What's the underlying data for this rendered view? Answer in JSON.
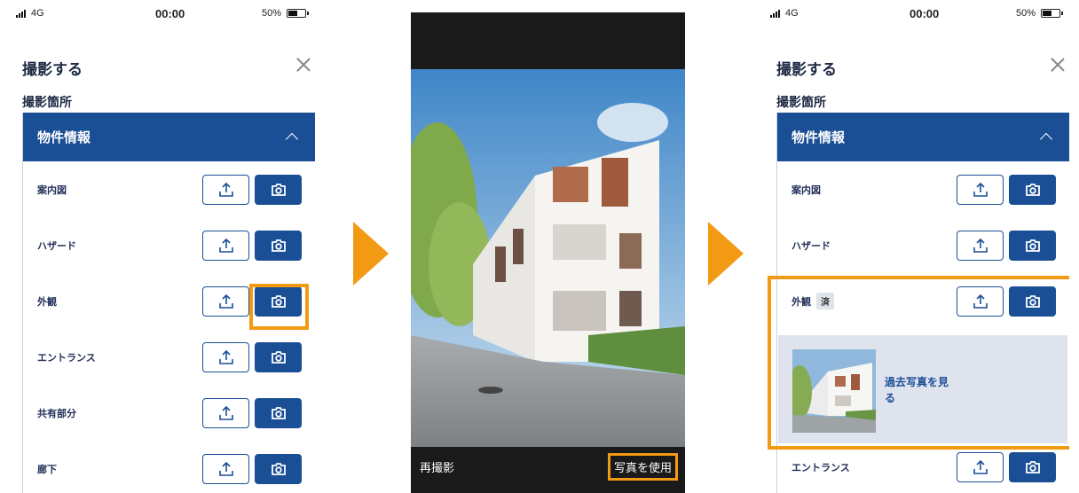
{
  "status_bar": {
    "network": "4G",
    "time": "00:00",
    "battery": "50%"
  },
  "modal": {
    "title": "撮影する",
    "section_label": "撮影箇所"
  },
  "accordion": {
    "header": "物件情報"
  },
  "left_rows": [
    {
      "label": "案内図"
    },
    {
      "label": "ハザード"
    },
    {
      "label": "外観"
    },
    {
      "label": "エントランス"
    },
    {
      "label": "共有部分"
    },
    {
      "label": "廊下"
    }
  ],
  "right_rows": [
    {
      "label": "案内図"
    },
    {
      "label": "ハザード"
    },
    {
      "label": "外観",
      "badge": "済"
    },
    {
      "label": "エントランス"
    }
  ],
  "camera": {
    "retake": "再撮影",
    "use_photo": "写真を使用"
  },
  "past_photo": {
    "link_line1": "過去写真を見",
    "link_line2": "る"
  },
  "colors": {
    "primary": "#1b4f95",
    "highlight": "#f29a14",
    "panel": "#dfe3ee"
  },
  "icons": {
    "upload": "upload-icon",
    "camera": "camera-icon",
    "close": "close-icon",
    "chevron": "chevron-up-icon"
  }
}
